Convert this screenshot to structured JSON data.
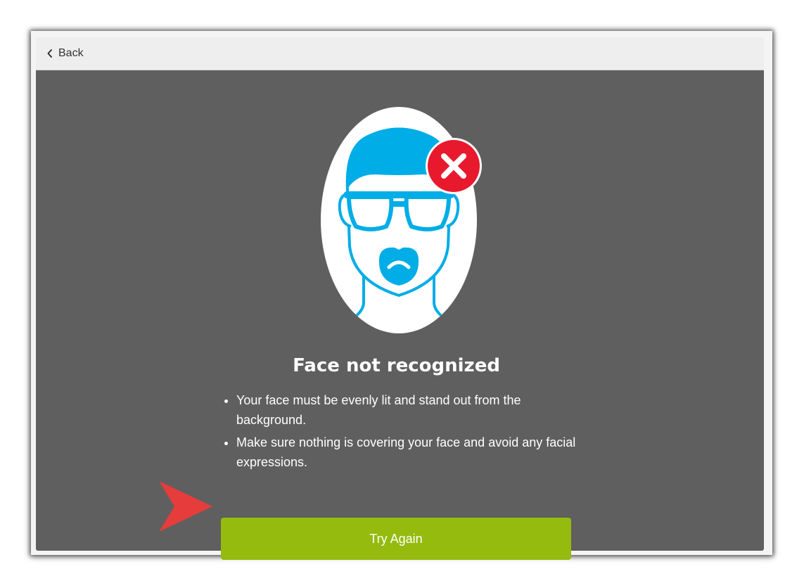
{
  "header": {
    "back_label": "Back"
  },
  "main": {
    "title": "Face not recognized",
    "tips": [
      "Your face must be evenly lit and stand out from the background.",
      "Make sure nothing is covering your face and avoid any facial expressions."
    ],
    "try_again_label": "Try Again"
  },
  "icons": {
    "back": "chevron-left-icon",
    "avatar": "face-with-sunglasses-icon",
    "error": "close-icon",
    "callout": "arrow-right-icon"
  },
  "colors": {
    "accent_green": "#95bb0e",
    "error_red": "#e8192c",
    "face_blue": "#00ade6",
    "content_bg": "#5f5f5f",
    "callout_red": "#e63c3c"
  }
}
